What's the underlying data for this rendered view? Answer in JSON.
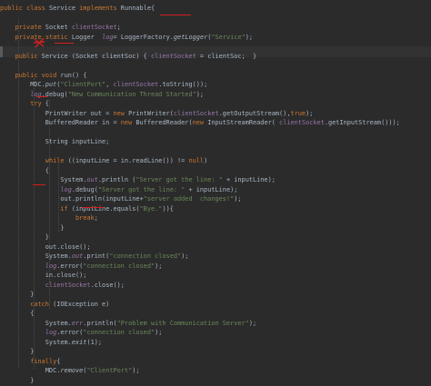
{
  "editor": {
    "lines": [
      "public class Service implements Runnable{",
      "",
      "    private Socket clientSocket;",
      "    private static Logger  log= LoggerFactory.getLogger(\"Service\");",
      "",
      "    public Service (Socket clientSoc) { clientSocket = clientSoc;  }",
      "",
      "    public void run() {",
      "        MDC.put(\"ClientPort\", clientSocket.toString());",
      "        log.debug(\"New Communication Thread Started\");",
      "        try {",
      "            PrintWriter out = new PrintWriter(clientSocket.getOutputStream(),true);",
      "            BufferedReader in = new BufferedReader(new InputStreamReader( clientSocket.getInputStream()));",
      "",
      "            String inputLine;",
      "",
      "            while ((inputLine = in.readLine()) != null)",
      "            {",
      "                System.out.println (\"Server got the line: \" + inputLine);",
      "                log.debug(\"Server got the line: \" + inputLine);",
      "                out.println(inputLine+\"server added  changes!\");",
      "                if (inputLine.equals(\"Bye.\")){",
      "                    break;",
      "                }",
      "            }",
      "            out.close();",
      "            System.out.print(\"connection closed\");",
      "            log.error(\"connection closed\");",
      "            in.close();",
      "            clientSocket.close();",
      "        }",
      "        catch (IOException e)",
      "        {",
      "            System.err.println(\"Problem with Communication Server\");",
      "            log.error(\"connection closed\");",
      "            System.exit(1);",
      "        }",
      "        finally{",
      "            MDC.remove(\"ClientPort\");",
      "        }"
    ]
  },
  "colors": {
    "background": "#2b2b2b",
    "keyword": "#cc7832",
    "text": "#a9b7c6",
    "field": "#9876aa",
    "string": "#6a8759",
    "method": "#ffc66d",
    "annotation_marks": "#d41f1f"
  }
}
